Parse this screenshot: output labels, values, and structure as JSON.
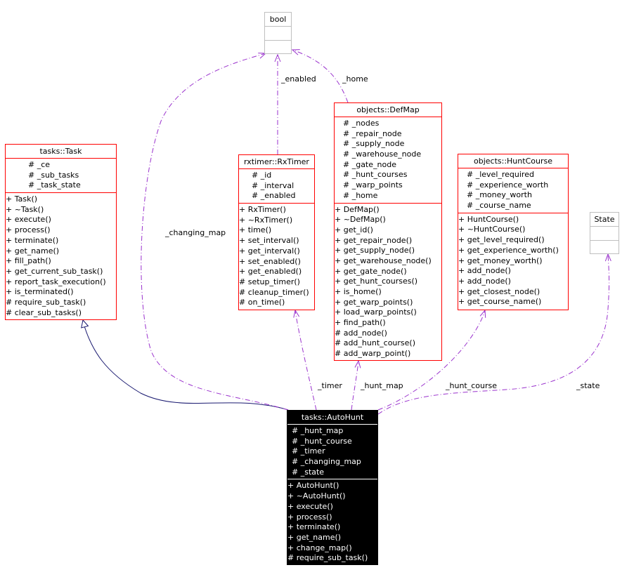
{
  "classes": [
    {
      "id": "bool",
      "name": "bool",
      "style": "gray",
      "attributes": [],
      "methods": []
    },
    {
      "id": "task",
      "name": "tasks::Task",
      "style": "red",
      "attributes": [
        "# _ce",
        "# _sub_tasks",
        "# _task_state"
      ],
      "methods": [
        "+ Task()",
        "+ ~Task()",
        "+ execute()",
        "+ process()",
        "+ terminate()",
        "+ get_name()",
        "+ fill_path()",
        "+ get_current_sub_task()",
        "+ report_task_execution()",
        "+ is_terminated()",
        "# require_sub_task()",
        "# clear_sub_tasks()"
      ]
    },
    {
      "id": "rxtimer",
      "name": "rxtimer::RxTimer",
      "style": "red",
      "attributes": [
        "# _id",
        "# _interval",
        "# _enabled"
      ],
      "methods": [
        "+ RxTimer()",
        "+ ~RxTimer()",
        "+ time()",
        "+ set_interval()",
        "+ get_interval()",
        "+ set_enabled()",
        "+ get_enabled()",
        "# setup_timer()",
        "# cleanup_timer()",
        "# on_time()"
      ]
    },
    {
      "id": "defmap",
      "name": "objects::DefMap",
      "style": "red",
      "attributes": [
        "# _nodes",
        "# _repair_node",
        "# _supply_node",
        "# _warehouse_node",
        "# _gate_node",
        "# _hunt_courses",
        "# _warp_points",
        "# _home"
      ],
      "methods": [
        "+ DefMap()",
        "+ ~DefMap()",
        "+ get_id()",
        "+ get_repair_node()",
        "+ get_supply_node()",
        "+ get_warehouse_node()",
        "+ get_gate_node()",
        "+ get_hunt_courses()",
        "+ is_home()",
        "+ get_warp_points()",
        "+ load_warp_points()",
        "+ find_path()",
        "# add_node()",
        "# add_hunt_course()",
        "# add_warp_point()"
      ]
    },
    {
      "id": "huntcourse",
      "name": "objects::HuntCourse",
      "style": "red",
      "attributes": [
        "# _level_required",
        "# _experience_worth",
        "# _money_worth",
        "# _course_name"
      ],
      "methods": [
        "+ HuntCourse()",
        "+ ~HuntCourse()",
        "+ get_level_required()",
        "+ get_experience_worth()",
        "+ get_money_worth()",
        "+ add_node()",
        "+ add_node()",
        "+ get_closest_node()",
        "+ get_course_name()"
      ]
    },
    {
      "id": "state",
      "name": "State",
      "style": "gray",
      "attributes": [],
      "methods": []
    },
    {
      "id": "autohunt",
      "name": "tasks::AutoHunt",
      "style": "dark",
      "attributes": [
        "# _hunt_map",
        "# _hunt_course",
        "# _timer",
        "# _changing_map",
        "# _state"
      ],
      "methods": [
        "+ AutoHunt()",
        "+ ~AutoHunt()",
        "+ execute()",
        "+ process()",
        "+ terminate()",
        "+ get_name()",
        "+ change_map()",
        "# require_sub_task()"
      ]
    }
  ],
  "edges": [
    {
      "id": "inherit-task",
      "from": "autohunt",
      "to": "task",
      "kind": "inheritance",
      "label": "",
      "color": "#191970"
    },
    {
      "id": "changing-map",
      "from": "autohunt",
      "to": "bool",
      "kind": "usage",
      "label": "_changing_map",
      "color": "#9a32cd"
    },
    {
      "id": "enabled",
      "from": "rxtimer",
      "to": "bool",
      "kind": "usage",
      "label": "_enabled",
      "color": "#9a32cd"
    },
    {
      "id": "home",
      "from": "defmap",
      "to": "bool",
      "kind": "usage",
      "label": "_home",
      "color": "#9a32cd"
    },
    {
      "id": "timer",
      "from": "autohunt",
      "to": "rxtimer",
      "kind": "usage",
      "label": "_timer",
      "color": "#9a32cd"
    },
    {
      "id": "hunt-map",
      "from": "autohunt",
      "to": "defmap",
      "kind": "usage",
      "label": "_hunt_map",
      "color": "#9a32cd"
    },
    {
      "id": "hunt-course",
      "from": "autohunt",
      "to": "huntcourse",
      "kind": "usage",
      "label": "_hunt_course",
      "color": "#9a32cd"
    },
    {
      "id": "state",
      "from": "autohunt",
      "to": "state",
      "kind": "usage",
      "label": "_state",
      "color": "#9a32cd"
    }
  ]
}
